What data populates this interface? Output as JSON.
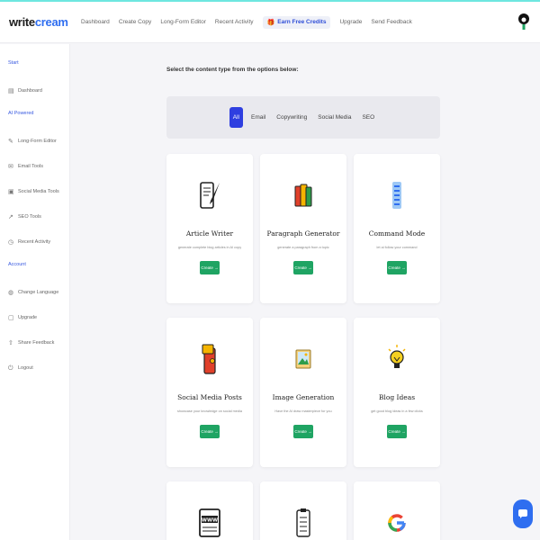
{
  "logo": {
    "part1": "write",
    "part2": "cream"
  },
  "nav": {
    "items": [
      "Dashboard",
      "Create Copy",
      "Long-Form Editor",
      "Recent Activity"
    ],
    "credits": "Earn Free Credits",
    "upgrade": "Upgrade",
    "feedback": "Send Feedback"
  },
  "sidebar": {
    "start_title": "Start",
    "dashboard": "Dashboard",
    "ai_title": "AI Powered",
    "ai_items": [
      "Long-Form Editor",
      "Email Tools",
      "Social Media Tools",
      "SEO Tools",
      "Recent Activity"
    ],
    "account_title": "Account",
    "account_items": [
      "Change Language",
      "Upgrade",
      "Share Feedback",
      "Logout"
    ]
  },
  "main": {
    "prompt": "Select the content type from the options below:",
    "filters": [
      "All",
      "Email",
      "Copywriting",
      "Social Media",
      "SEO"
    ],
    "active_filter": "All",
    "cards": [
      {
        "title": "Article Writer",
        "desc": "generate complete blog articles in AI copy",
        "btn": "Create →",
        "icon": "quill-scroll-icon"
      },
      {
        "title": "Paragraph Generator",
        "desc": "generate a paragraph from a topic",
        "btn": "Create →",
        "icon": "books-icon"
      },
      {
        "title": "Command Mode",
        "desc": "let ai follow your command",
        "btn": "Create →",
        "icon": "command-list-icon"
      },
      {
        "title": "Social Media Posts",
        "desc": "showcase your knowledge on social media",
        "btn": "Create →",
        "icon": "phone-post-icon"
      },
      {
        "title": "Image Generation",
        "desc": "Have the AI draw masterpiece for you",
        "btn": "Create →",
        "icon": "picture-icon"
      },
      {
        "title": "Blog Ideas",
        "desc": "get good blog ideas in a few clicks",
        "btn": "Create →",
        "icon": "lightbulb-icon"
      }
    ],
    "partial_cards": [
      {
        "icon": "www-browser-icon"
      },
      {
        "icon": "checklist-icon"
      },
      {
        "icon": "google-icon"
      }
    ]
  },
  "colors": {
    "brand_blue": "#2f6ef0",
    "active_filter": "#2f3fe0",
    "create_green": "#1fa463"
  }
}
